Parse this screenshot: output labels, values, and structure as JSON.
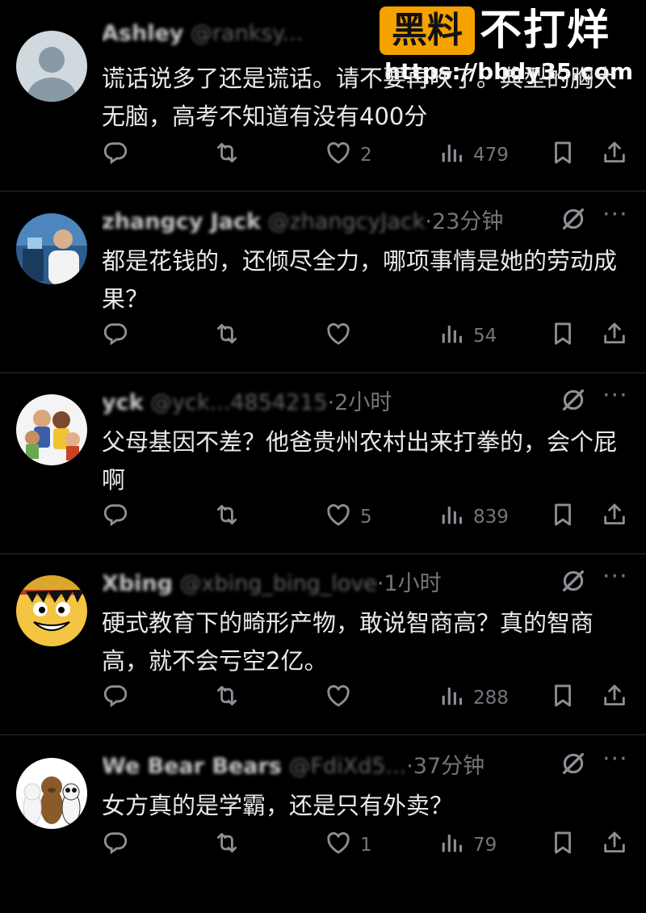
{
  "watermark": {
    "badge": "黑料",
    "title": "不打烊",
    "url": "https://bbdy35.com"
  },
  "more_label": "···",
  "tweets": [
    {
      "name": "Ashley",
      "handle": "@ranksy...",
      "time": "",
      "text": "谎话说多了还是谎话。请不要再吹了。典型的胸大无脑，高考不知道有没有400分",
      "replies": "",
      "retweets": "",
      "likes": "2",
      "views": "479"
    },
    {
      "name": "zhangcy Jack",
      "handle": "@zhangcyJack",
      "time": "·23分钟",
      "text": "都是花钱的，还倾尽全力，哪项事情是她的劳动成果？",
      "replies": "",
      "retweets": "",
      "likes": "",
      "views": "54"
    },
    {
      "name": "yck",
      "handle": "@yck...4854215",
      "time": "·2小时",
      "text": "父母基因不差？他爸贵州农村出来打拳的，会个屁啊",
      "replies": "",
      "retweets": "",
      "likes": "5",
      "views": "839"
    },
    {
      "name": "Xbing",
      "handle": "@xbing_bing_love",
      "time": "·1小时",
      "text": "硬式教育下的畸形产物，敢说智商高？真的智商高，就不会亏空2亿。",
      "replies": "",
      "retweets": "",
      "likes": "",
      "views": "288"
    },
    {
      "name": "We Bear Bears",
      "handle": "@FdiXd5...",
      "time": "·37分钟",
      "text": "女方真的是学霸，还是只有外卖？",
      "replies": "",
      "retweets": "",
      "likes": "1",
      "views": "79"
    }
  ]
}
